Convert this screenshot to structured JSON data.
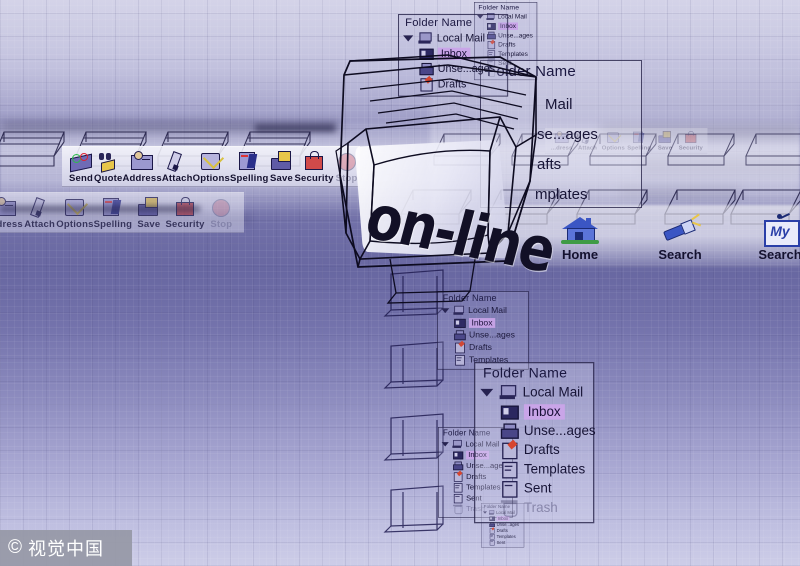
{
  "scene": {
    "title": "on-line",
    "monitor_screen_text": "on-line",
    "background_accent": "#6f6eb0",
    "highlight_color": "#c9a5e8"
  },
  "folder_panel": {
    "header": "Folder Name",
    "root": "Local Mail",
    "items": [
      {
        "label": "Inbox",
        "icon": "inbox-icon",
        "state": "selected"
      },
      {
        "label": "Unse...ages",
        "icon": "outbox-icon",
        "state": "normal"
      },
      {
        "label": "Drafts",
        "icon": "drafts-icon",
        "state": "normal"
      },
      {
        "label": "Templates",
        "icon": "templates-icon",
        "state": "normal"
      },
      {
        "label": "Sent",
        "icon": "sent-icon",
        "state": "normal"
      },
      {
        "label": "Trash",
        "icon": "trash-icon",
        "state": "disabled"
      }
    ]
  },
  "compose_toolbar": {
    "buttons": [
      {
        "label": "Send",
        "icon": "send-icon",
        "state": "enabled"
      },
      {
        "label": "Quote",
        "icon": "quote-icon",
        "state": "enabled"
      },
      {
        "label": "Address",
        "icon": "address-book-icon",
        "state": "enabled"
      },
      {
        "label": "Attach",
        "icon": "attach-pen-icon",
        "state": "enabled"
      },
      {
        "label": "Options",
        "icon": "options-check-icon",
        "state": "enabled"
      },
      {
        "label": "Spelling",
        "icon": "spelling-icon",
        "state": "enabled"
      },
      {
        "label": "Save",
        "icon": "save-icon",
        "state": "enabled"
      },
      {
        "label": "Security",
        "icon": "security-lock-icon",
        "state": "enabled"
      },
      {
        "label": "Stop",
        "icon": "stop-icon",
        "state": "disabled"
      }
    ]
  },
  "compose_toolbar_secondary": {
    "buttons": [
      {
        "label": "...dress",
        "icon": "address-book-icon",
        "state": "enabled"
      },
      {
        "label": "Attach",
        "icon": "attach-pen-icon",
        "state": "enabled"
      },
      {
        "label": "Options",
        "icon": "options-check-icon",
        "state": "enabled"
      },
      {
        "label": "Spelling",
        "icon": "spelling-icon",
        "state": "enabled"
      },
      {
        "label": "Save",
        "icon": "save-icon",
        "state": "enabled"
      },
      {
        "label": "Security",
        "icon": "security-lock-icon",
        "state": "enabled"
      },
      {
        "label": "Stop",
        "icon": "stop-icon",
        "state": "disabled"
      }
    ]
  },
  "browser_nav": {
    "buttons": [
      {
        "label": "Home",
        "icon": "house-icon"
      },
      {
        "label": "Search",
        "icon": "flashlight-search-icon"
      },
      {
        "label": "Search",
        "icon": "my-search-icon",
        "badge": "My"
      }
    ]
  },
  "occluded_panel": {
    "header": "Folder Name",
    "rows": [
      "Mail",
      "se...ages",
      "afts",
      "mplates"
    ]
  },
  "watermark": {
    "copyright": "©",
    "text": "视觉中国"
  }
}
